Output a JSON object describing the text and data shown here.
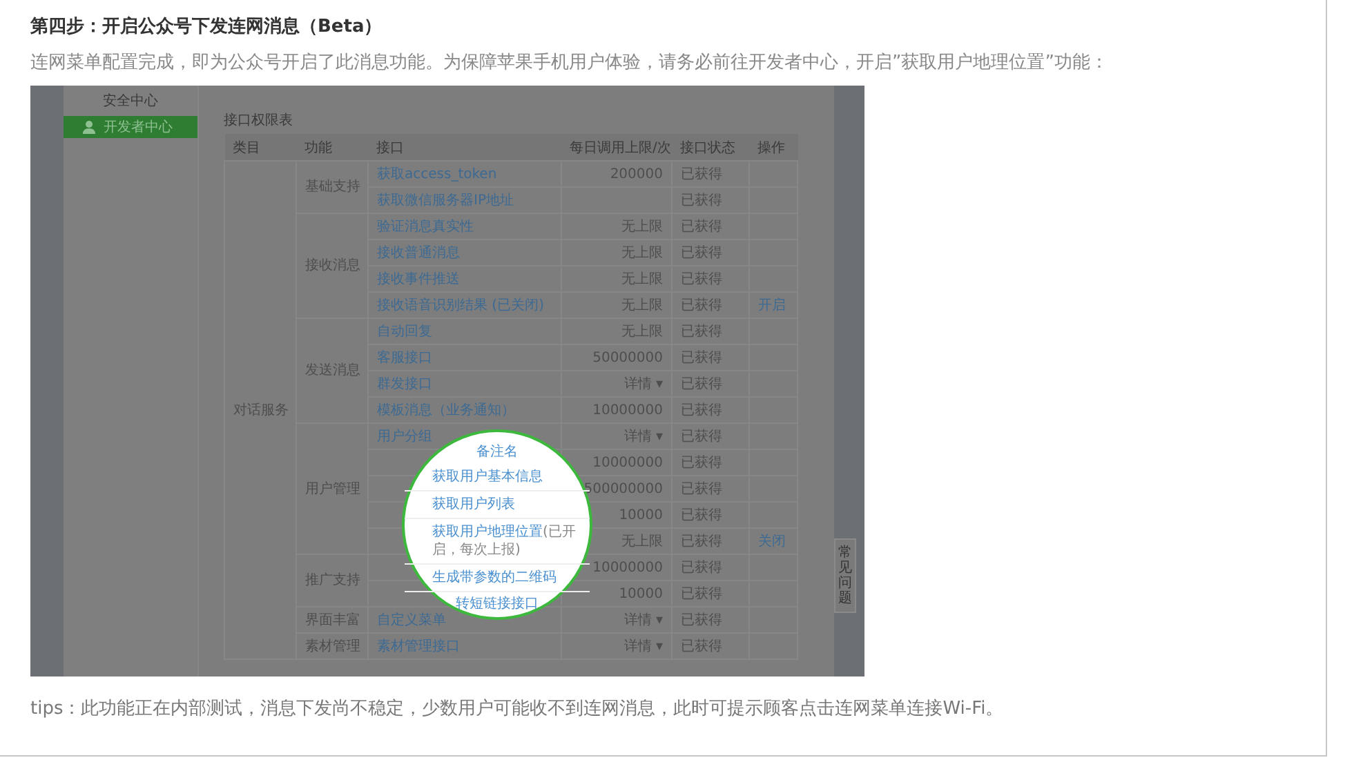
{
  "heading": "第四步：开启公众号下发连网消息（Beta）",
  "intro": "连网菜单配置完成，即为公众号开启了此消息功能。为保障苹果手机用户体验，请务必前往开发者中心，开启”获取用户地理位置”功能：",
  "screenshot": {
    "sidebar": {
      "section": "安全中心",
      "items": [
        {
          "label": "开发者中心",
          "selected": true
        }
      ]
    },
    "table": {
      "title": "接口权限表",
      "columns": [
        "类目",
        "功能",
        "接口",
        "每日调用上限/次",
        "接口状态",
        "操作"
      ],
      "groups": [
        {
          "category": "对话服务",
          "functions": [
            {
              "name": "基础支持",
              "rows": [
                {
                  "interface": "获取access_token",
                  "limit": "200000",
                  "status": "已获得"
                },
                {
                  "interface": "获取微信服务器IP地址",
                  "status": "已获得"
                }
              ]
            },
            {
              "name": "接收消息",
              "rows": [
                {
                  "interface": "验证消息真实性",
                  "limit": "无上限",
                  "status": "已获得"
                },
                {
                  "interface": "接收普通消息",
                  "limit": "无上限",
                  "status": "已获得"
                },
                {
                  "interface": "接收事件推送",
                  "limit": "无上限",
                  "status": "已获得"
                },
                {
                  "interface": "接收语音识别结果 (已关闭)",
                  "limit": "无上限",
                  "status": "已获得",
                  "action": "开启"
                }
              ]
            },
            {
              "name": "发送消息",
              "rows": [
                {
                  "interface": "自动回复",
                  "limit": "无上限",
                  "status": "已获得"
                },
                {
                  "interface": "客服接口",
                  "limit": "50000000",
                  "status": "已获得"
                },
                {
                  "interface": "群发接口",
                  "limit": "详情 ▾",
                  "status": "已获得"
                },
                {
                  "interface": "模板消息（业务通知）",
                  "limit": "10000000",
                  "status": "已获得"
                }
              ]
            },
            {
              "name": "用户管理",
              "rows": [
                {
                  "interface": "用户分组",
                  "limit": "详情 ▾",
                  "status": "已获得"
                },
                {
                  "limit": "10000000",
                  "status": "已获得"
                },
                {
                  "limit": "500000000",
                  "status": "已获得"
                },
                {
                  "limit": "10000",
                  "status": "已获得"
                },
                {
                  "limit": "无上限",
                  "status": "已获得",
                  "action": "关闭"
                }
              ]
            },
            {
              "name": "推广支持",
              "rows": [
                {
                  "limit": "10000000",
                  "status": "已获得"
                },
                {
                  "limit": "10000",
                  "status": "已获得"
                }
              ]
            },
            {
              "name": "界面丰富",
              "rows": [
                {
                  "interface": "自定义菜单",
                  "limit": "详情 ▾",
                  "status": "已获得"
                }
              ]
            },
            {
              "name": "素材管理",
              "rows": [
                {
                  "interface": "素材管理接口",
                  "limit": "详情 ▾",
                  "status": "已获得"
                }
              ]
            }
          ]
        }
      ]
    },
    "help_tab": "常见问题",
    "magnifier": {
      "rows": [
        {
          "text": "备注名"
        },
        {
          "text": "获取用户基本信息"
        },
        {
          "text": "获取用户列表"
        },
        {
          "text": "获取用户地理位置",
          "note": "(已开启，每次上报)"
        },
        {
          "text": "生成带参数的二维码"
        },
        {
          "text": "转短链接接口"
        }
      ]
    }
  },
  "tips": "tips：此功能正在内部测试，消息下发尚不稳定，少数用户可能收不到连网消息，此时可提示顾客点击连网菜单连接Wi-Fi。"
}
